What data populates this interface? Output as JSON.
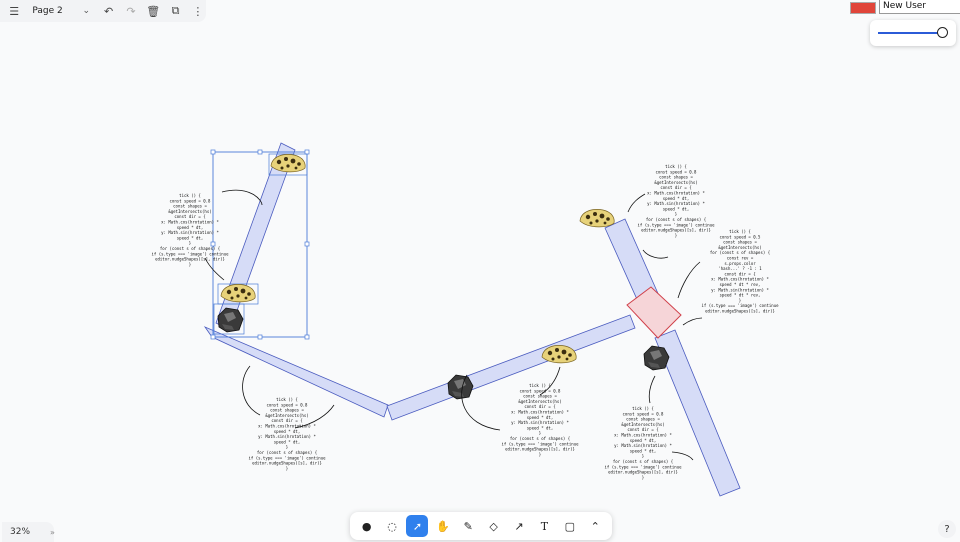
{
  "topbar": {
    "page_name": "Page 2",
    "icons": [
      "menu-icon",
      "chevron-down-icon",
      "undo-icon",
      "redo-icon",
      "trash-icon",
      "duplicate-icon",
      "more-icon"
    ]
  },
  "user": {
    "name": "New User",
    "color": "#e0453a"
  },
  "zoom": {
    "level": "32%"
  },
  "help": {
    "label": "?"
  },
  "toolbar": {
    "tools": [
      "draw-dot",
      "lasso",
      "select",
      "hand",
      "pencil",
      "eraser",
      "arrow",
      "text",
      "rectangle",
      "chevron-up"
    ],
    "active": "select",
    "text_label": "T"
  },
  "code_block": [
    "tick () {",
    "const speed = 0.8",
    "const shapes =",
    "&getIntersects(hs)",
    "const dir = {",
    "x: Math.cos(hrotation) *",
    "speed * dt,",
    "y: Math.sin(hrotation) *",
    "speed * dt,",
    "}",
    "for (const s of shapes) {",
    "if (s.type === 'image') continue",
    "editor.nudgeShapes([s], dir)}",
    "}"
  ],
  "code_block_alt": [
    "tick () {",
    "const speed = 0.5",
    "const shapes =",
    "&getIntersects(hs)",
    "for (const s of shapes) {",
    "const rev =",
    "s.props.color",
    "'hash...' ? -1 : 1",
    "const dir = {",
    "x: Math.cos(hrotation) *",
    "speed * dt * rev,",
    "y: Math.sin(hrotation) *",
    "speed * dt * rev,",
    "}",
    "if (s.type === 'image') continue",
    "editor.nudgeShapes([s], dir)}"
  ],
  "colors": {
    "belt_fill": "#d6dcf7",
    "belt_stroke": "#4a5bbf",
    "box_fill": "#f6d5d8",
    "box_stroke": "#d0404a",
    "selection": "#4a7bd8"
  }
}
